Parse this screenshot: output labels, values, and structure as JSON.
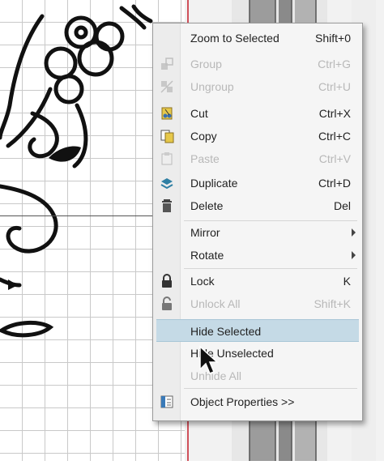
{
  "context_menu": {
    "items": [
      {
        "label": "Zoom to Selected",
        "shortcut": "Shift+0",
        "icon": "none",
        "state": "enabled"
      },
      {
        "label": "Group",
        "shortcut": "Ctrl+G",
        "icon": "group-icon",
        "state": "disabled"
      },
      {
        "label": "Ungroup",
        "shortcut": "Ctrl+U",
        "icon": "ungroup-icon",
        "state": "disabled"
      },
      {
        "label": "Cut",
        "shortcut": "Ctrl+X",
        "icon": "cut-icon",
        "state": "enabled"
      },
      {
        "label": "Copy",
        "shortcut": "Ctrl+C",
        "icon": "copy-icon",
        "state": "enabled"
      },
      {
        "label": "Paste",
        "shortcut": "Ctrl+V",
        "icon": "paste-icon",
        "state": "disabled"
      },
      {
        "label": "Duplicate",
        "shortcut": "Ctrl+D",
        "icon": "duplicate-icon",
        "state": "enabled"
      },
      {
        "label": "Delete",
        "shortcut": "Del",
        "icon": "trash-icon",
        "state": "enabled"
      },
      {
        "label": "Mirror",
        "shortcut": "",
        "icon": "none",
        "state": "enabled",
        "submenu": true
      },
      {
        "label": "Rotate",
        "shortcut": "",
        "icon": "none",
        "state": "enabled",
        "submenu": true
      },
      {
        "label": "Lock",
        "shortcut": "K",
        "icon": "lock-icon",
        "state": "enabled"
      },
      {
        "label": "Unlock All",
        "shortcut": "Shift+K",
        "icon": "unlock-icon",
        "state": "disabled"
      },
      {
        "label": "Hide Selected",
        "shortcut": "",
        "icon": "none",
        "state": "highlighted"
      },
      {
        "label": "Hide Unselected",
        "shortcut": "",
        "icon": "none",
        "state": "enabled"
      },
      {
        "label": "Unhide All",
        "shortcut": "",
        "icon": "none",
        "state": "disabled"
      },
      {
        "label": "Object Properties >>",
        "shortcut": "",
        "icon": "properties-icon",
        "state": "enabled"
      }
    ]
  },
  "colors": {
    "highlight": "#c5dae6",
    "disabled_text": "#b8b8b8",
    "ruler_red": "#d0505a"
  }
}
